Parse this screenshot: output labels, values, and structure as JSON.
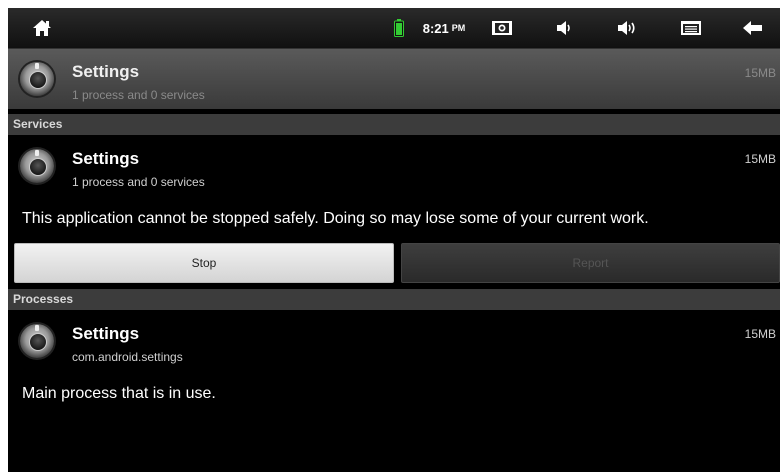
{
  "status_bar": {
    "time": "8:21",
    "ampm": "PM",
    "icons": [
      "home-icon",
      "battery-icon",
      "screenshot-icon",
      "volume-down-icon",
      "volume-up-icon",
      "menu-icon",
      "back-icon"
    ]
  },
  "header": {
    "app_name": "Settings",
    "subtitle": "1 process and 0 services",
    "size": "15MB"
  },
  "services": {
    "section_label": "Services",
    "app_name": "Settings",
    "subtitle": "1 process and 0 services",
    "size": "15MB",
    "warning": "This application cannot be stopped safely. Doing so may lose some of your current work.",
    "stop_label": "Stop",
    "report_label": "Report"
  },
  "processes": {
    "section_label": "Processes",
    "app_name": "Settings",
    "package": "com.android.settings",
    "size": "15MB",
    "description": "Main process that is in use."
  },
  "colors": {
    "background": "#000000",
    "section_header": "#3c3c3c",
    "stop_button": "#e6e6e6",
    "report_button": "#333333"
  }
}
